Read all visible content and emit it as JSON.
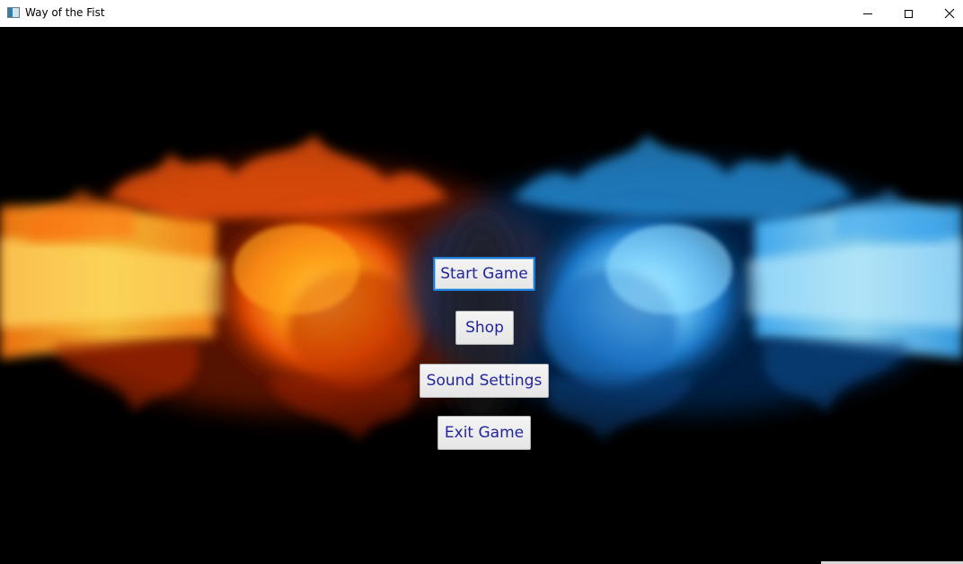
{
  "window": {
    "title": "Way of the Fist",
    "icon": "app-window-icon",
    "controls": {
      "minimize_icon": "minimize-icon",
      "maximize_icon": "maximize-icon",
      "close_icon": "close-icon"
    }
  },
  "background": {
    "description_icon": "fire-ice-fists-artwork",
    "left_color": "#ff6a00",
    "right_color": "#3fb8ff",
    "base_color": "#000000"
  },
  "menu": {
    "start_label": "Start Game",
    "shop_label": "Shop",
    "sound_label": "Sound Settings",
    "exit_label": "Exit Game",
    "text_color": "#22259a",
    "focus_color": "#1f7ad0"
  }
}
